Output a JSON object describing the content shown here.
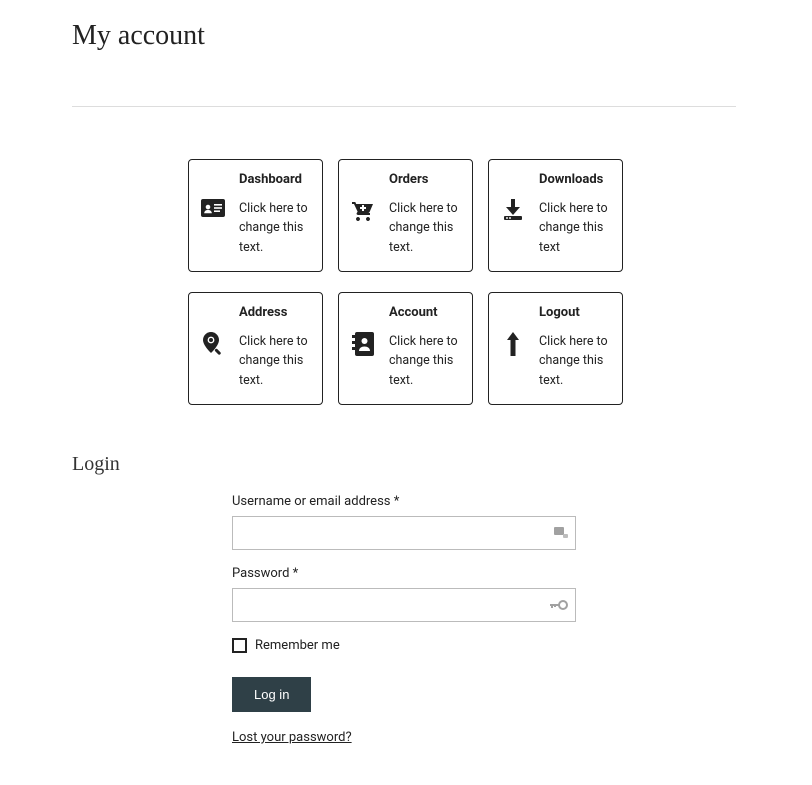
{
  "page": {
    "title": "My account"
  },
  "tiles": [
    {
      "title": "Dashboard",
      "desc": "Click here to change this text."
    },
    {
      "title": "Orders",
      "desc": "Click here to change this text."
    },
    {
      "title": "Downloads",
      "desc": "Click here to change this text"
    },
    {
      "title": "Address",
      "desc": "Click here to change this text."
    },
    {
      "title": "Account",
      "desc": "Click here to change this text."
    },
    {
      "title": "Logout",
      "desc": "Click here to change this text."
    }
  ],
  "login": {
    "heading": "Login",
    "username_label": "Username or email address *",
    "password_label": "Password *",
    "remember_label": "Remember me",
    "submit_label": "Log in",
    "lost_password_label": "Lost your password?"
  }
}
